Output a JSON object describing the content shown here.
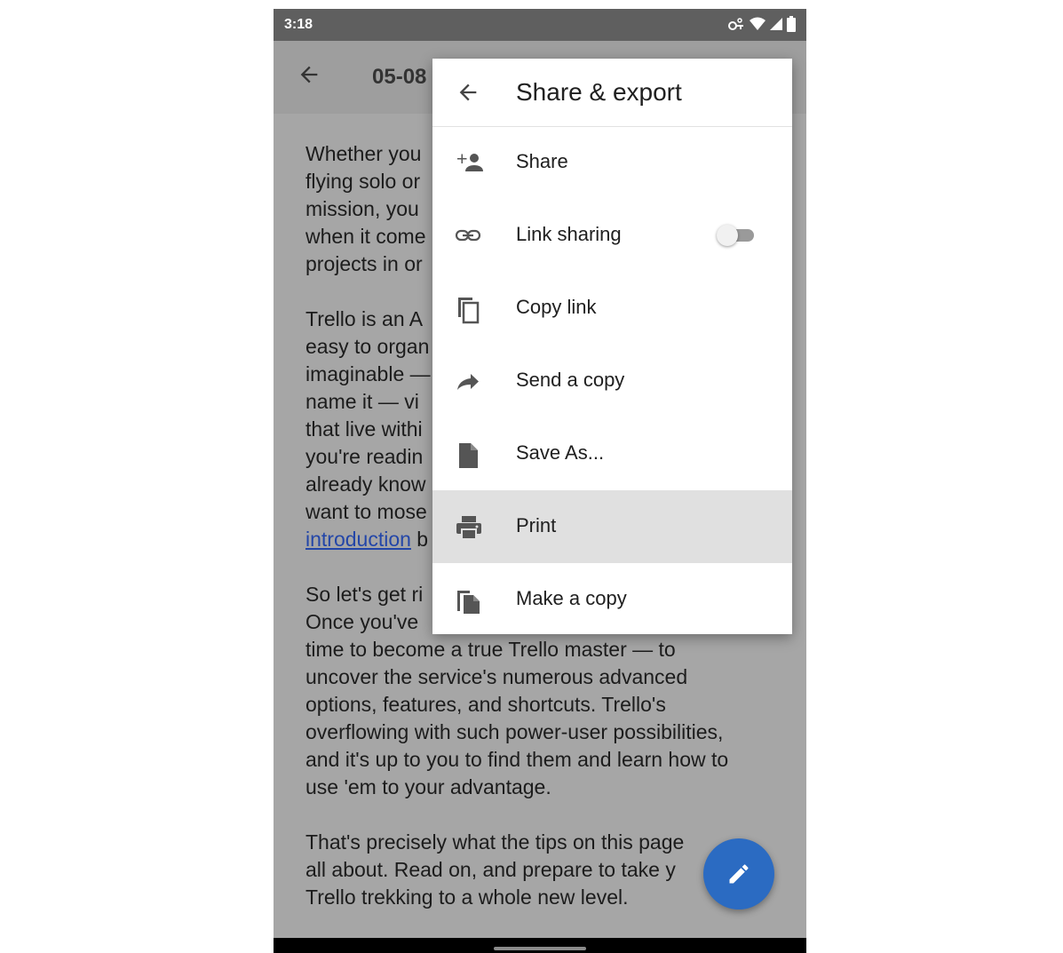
{
  "status_bar": {
    "time": "3:18"
  },
  "app_bar": {
    "title": "05-08"
  },
  "document": {
    "paragraphs": [
      "Whether you\nflying solo or\nmission, you\nwhen it come\nprojects in or",
      "Trello is an A\neasy to organ\nimaginable —\nname it — vi\nthat live withi\nyou're readin\nalready know\nwant to mose",
      "So let's get ri\nOnce you've\ntime to become a true Trello master — to\nuncover the service's numerous advanced\noptions, features, and shortcuts. Trello's\noverflowing with such power-user possibilities,\nand it's up to you to find them and learn how to\nuse 'em to your advantage.",
      "That's precisely what the tips on this page\nall about. Read on, and prepare to take y\nTrello trekking to a whole new level."
    ],
    "link_text": "introduction",
    "link_suffix": " b"
  },
  "menu": {
    "title": "Share & export",
    "items": [
      {
        "label": "Share",
        "icon": "add-person-icon"
      },
      {
        "label": "Link sharing",
        "icon": "link-icon",
        "toggle_on": false
      },
      {
        "label": "Copy link",
        "icon": "copy-icon"
      },
      {
        "label": "Send a copy",
        "icon": "forward-arrow-icon"
      },
      {
        "label": "Save As...",
        "icon": "file-icon"
      },
      {
        "label": "Print",
        "icon": "print-icon",
        "highlighted": true
      },
      {
        "label": "Make a copy",
        "icon": "file-copy-icon"
      }
    ]
  },
  "colors": {
    "fab": "#2b6bc2",
    "link": "#2346a8",
    "scrim": "#a6a6a6",
    "highlight": "#e0e0e0"
  }
}
